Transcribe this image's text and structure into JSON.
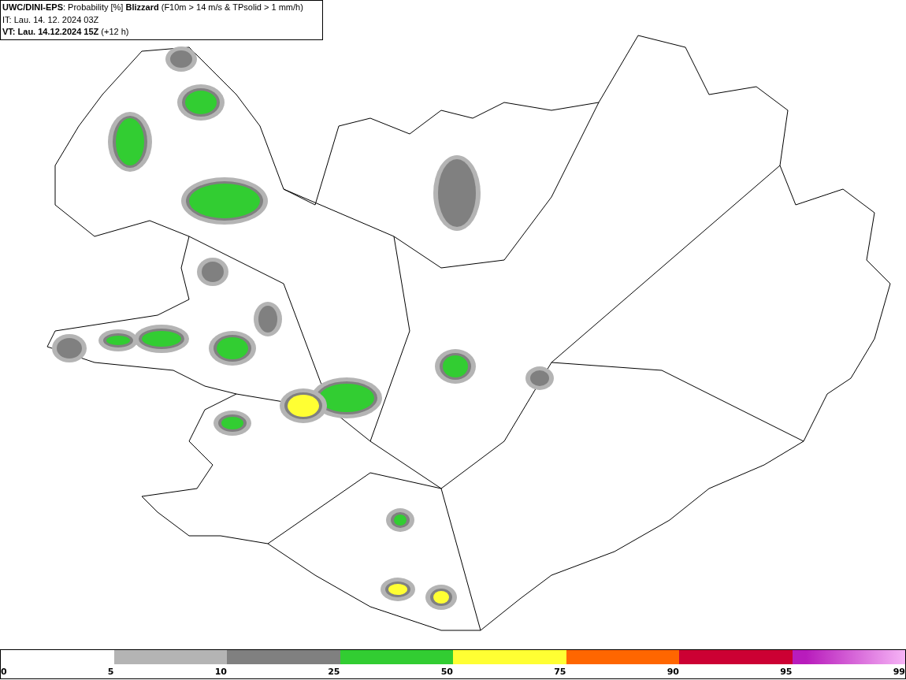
{
  "header": {
    "lines": [
      "**UWC/DINI-EPS**: Probability [%] **Blizzard** (F10m > 14 m/s & TPsolid > 1 mm/h)",
      "IT: Lau. 14. 12. 2024 03Z",
      "**VT: Lau. 14.12.2024 15Z** (+12 h)"
    ]
  },
  "legend": {
    "segments": [
      {
        "kind": "solid",
        "color": "#b4b4b4"
      },
      {
        "kind": "solid",
        "color": "#808080"
      },
      {
        "kind": "solid",
        "color": "#32cd32"
      },
      {
        "kind": "solid",
        "color": "#ffff33"
      },
      {
        "kind": "solid",
        "color": "#ff6600"
      },
      {
        "kind": "solid",
        "color": "#cc0033"
      },
      {
        "kind": "gradient",
        "color": "#b81cbc"
      }
    ],
    "ticks": [
      "0",
      "5",
      "10",
      "25",
      "50",
      "75",
      "90",
      "95",
      "99"
    ]
  }
}
